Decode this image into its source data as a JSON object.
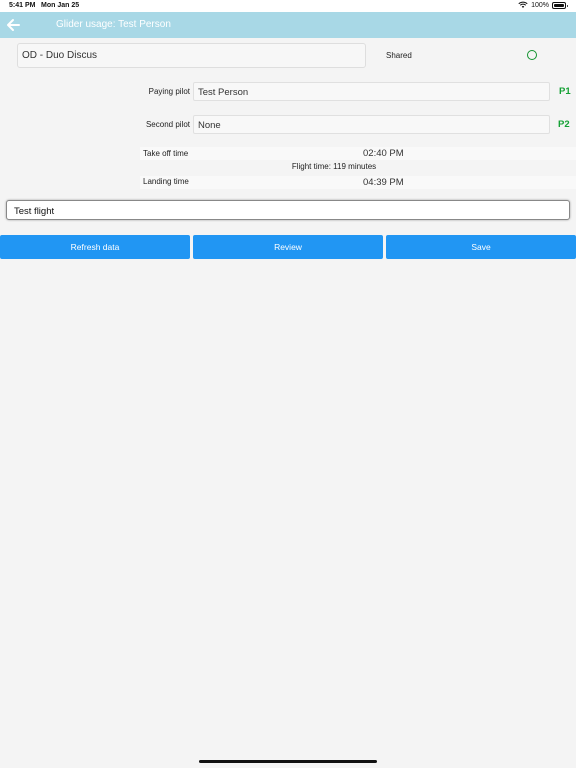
{
  "status_bar": {
    "time": "5:41 PM",
    "date": "Mon Jan 25",
    "battery": "100%"
  },
  "nav": {
    "title": "Glider usage: Test Person",
    "back_icon": "arrow-left-icon"
  },
  "glider": {
    "value": "OD - Duo Discus",
    "shared_label": "Shared",
    "shared_checked": false
  },
  "paying_pilot": {
    "label": "Paying pilot",
    "value": "Test Person",
    "badge": "P1"
  },
  "second_pilot": {
    "label": "Second pilot",
    "value": "None",
    "badge": "P2"
  },
  "times": {
    "takeoff_label": "Take off time",
    "takeoff_value": "02:40 PM",
    "flight_time": "Flight time: 119 minutes",
    "landing_label": "Landing time",
    "landing_value": "04:39 PM"
  },
  "notes": {
    "value": "Test flight"
  },
  "buttons": {
    "refresh": "Refresh data",
    "review": "Review",
    "save": "Save"
  },
  "colors": {
    "nav_bg": "#a8d8e6",
    "accent_green": "#15a135",
    "button_blue": "#2196f3",
    "background": "#f4f4f4"
  }
}
